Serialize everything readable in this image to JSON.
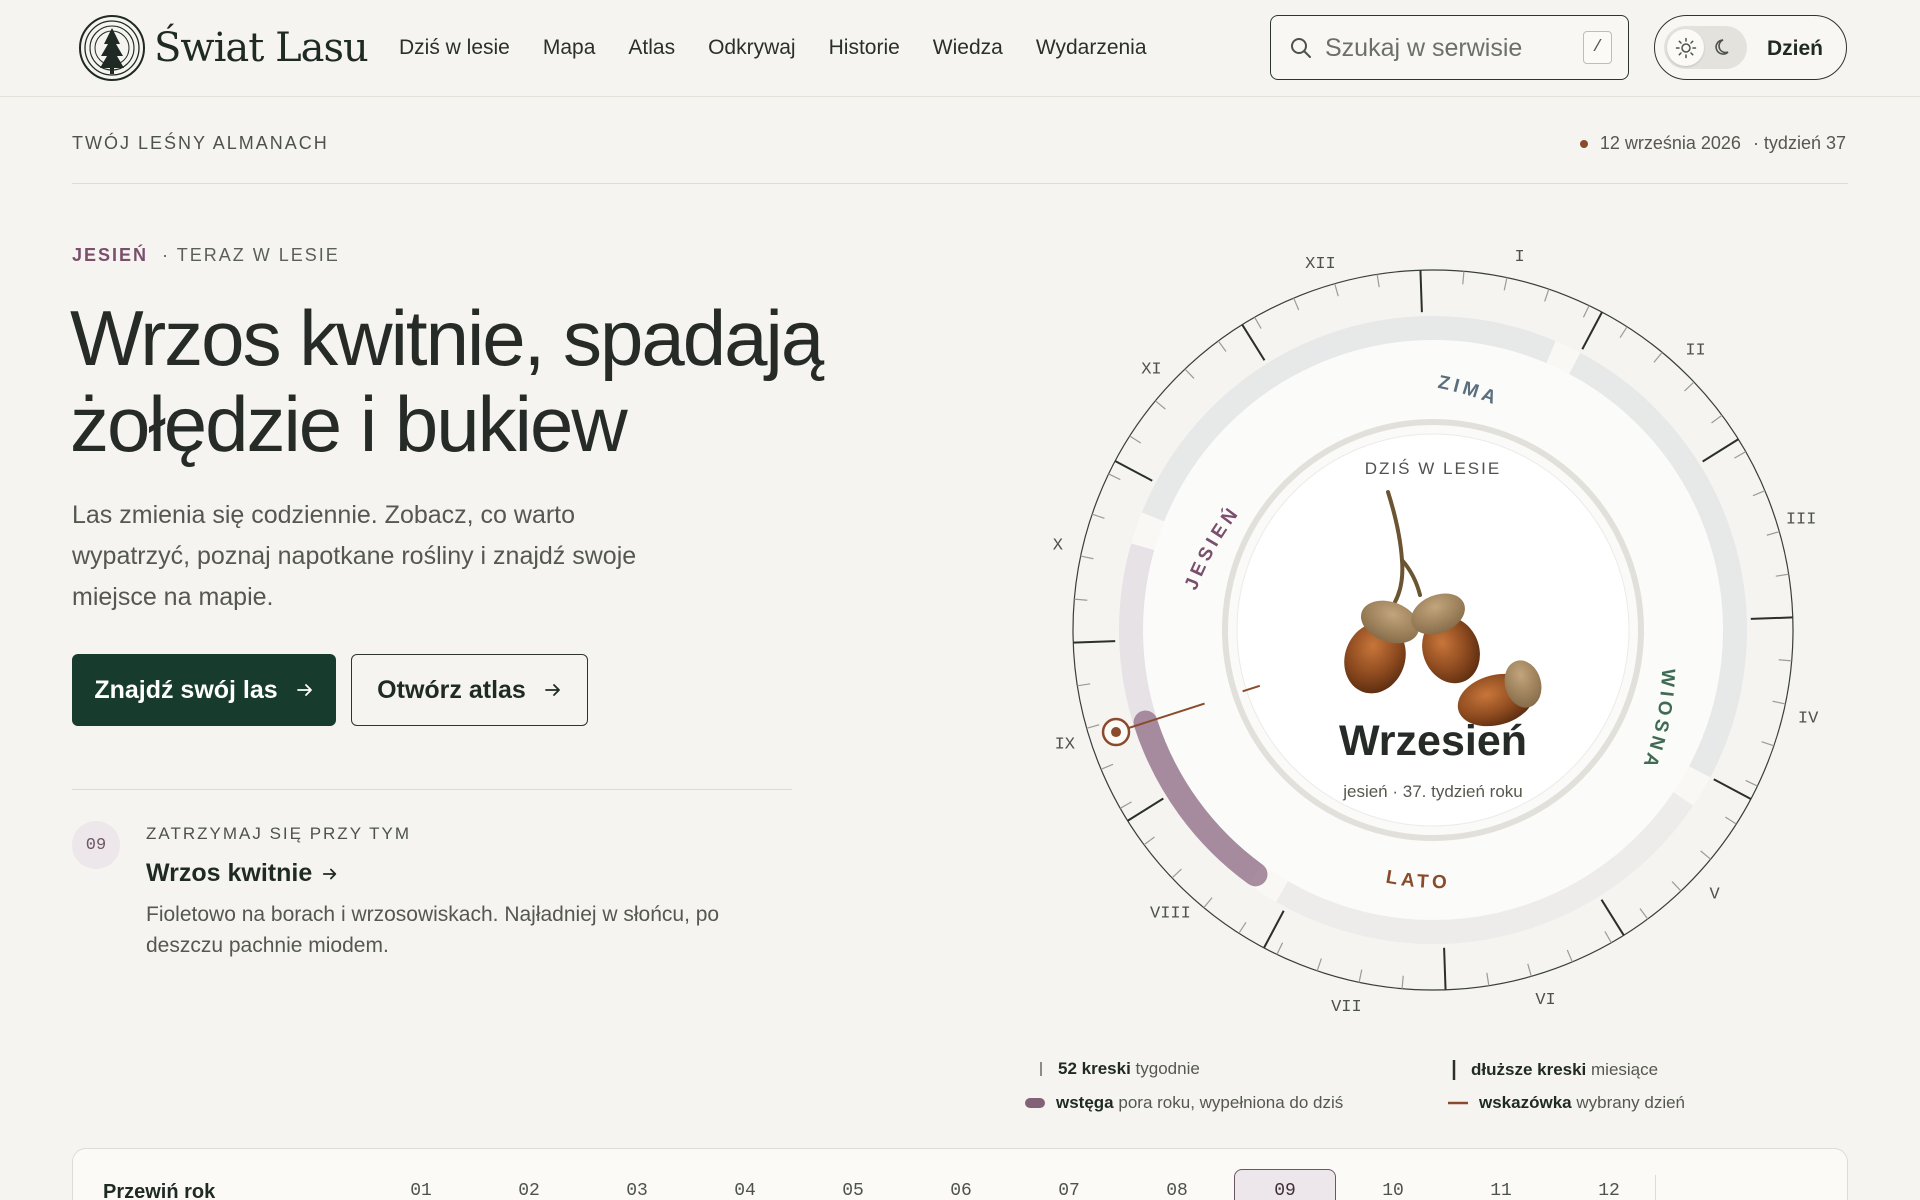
{
  "brand": {
    "name": "Świat Lasu"
  },
  "nav": [
    "Dziś w lesie",
    "Mapa",
    "Atlas",
    "Odkrywaj",
    "Historie",
    "Wiedza",
    "Wydarzenia"
  ],
  "search": {
    "placeholder": "Szukaj w serwisie",
    "shortcut": "/"
  },
  "theme": {
    "label": "Dzień"
  },
  "almanach": "TWÓJ LEŚNY ALMANACH",
  "date": {
    "day": "12 września 2026",
    "week": "· tydzień 37"
  },
  "hero": {
    "season": "JESIEŃ",
    "now": "· TERAZ W LESIE",
    "title": "Wrzos kwitnie, spadają żołędzie i bukiew",
    "subtitle": "Las zmienia się codziennie. Zobacz, co warto wypatrzyć, poznaj napotkane rośliny i znajdź swoje miejsce na mapie.",
    "btn_primary": "Znajdź swój las",
    "btn_secondary": "Otwórz atlas"
  },
  "tip": {
    "num": "09",
    "kicker": "ZATRZYMAJ SIĘ PRZY TYM",
    "title": "Wrzos kwitnie",
    "text": "Fioletowo na borach i wrzosowiskach. Najładniej w słońcu, po deszczu pachnie miodem."
  },
  "dial": {
    "months": [
      "I",
      "II",
      "III",
      "IV",
      "V",
      "VI",
      "VII",
      "VIII",
      "IX",
      "X",
      "XI",
      "XII"
    ],
    "seasons": [
      "ZIMA",
      "WIOSNA",
      "LATO",
      "JESIEŃ"
    ],
    "center_kicker": "DZIŚ W LESIE",
    "center_title": "Wrzesień",
    "center_sub": "jesień · 37. tydzień roku",
    "current_week": 37,
    "colors": {
      "zima": "#5a6f7e",
      "wiosna": "#3f6b52",
      "lato": "#8a4a2c",
      "jesien": "#7a4f6d"
    }
  },
  "legend": {
    "weeks_b": "52 kreski",
    "weeks_t": "tygodnie",
    "months_b": "dłuższe kreski",
    "months_t": "miesiące",
    "band_b": "wstęga",
    "band_t": "pora roku, wypełniona do dziś",
    "hand_b": "wskazówka",
    "hand_t": "wybrany dzień"
  },
  "yearbar": {
    "label": "Przewiń rok",
    "months": [
      "01",
      "02",
      "03",
      "04",
      "05",
      "06",
      "07",
      "08",
      "09",
      "10",
      "11",
      "12"
    ],
    "active": "09"
  }
}
